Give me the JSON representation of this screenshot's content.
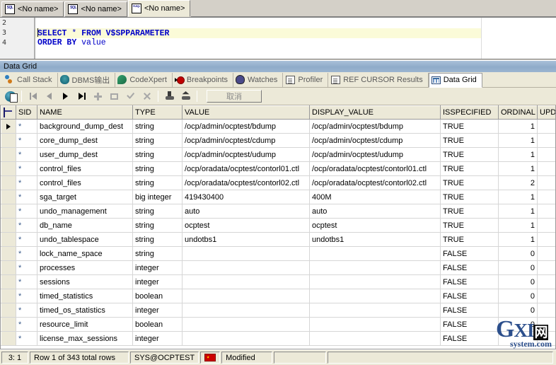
{
  "document_tabs": [
    {
      "label": "<No name>",
      "icon": "sql-document-icon",
      "active": false
    },
    {
      "label": "<No name>",
      "icon": "sql-document-icon",
      "active": false
    },
    {
      "label": "<No name>",
      "icon": "plsql-document-icon",
      "active": true
    }
  ],
  "editor": {
    "gutter": [
      "2",
      "3",
      "4"
    ],
    "lines": [
      {
        "number": "2",
        "text": "",
        "current": false
      },
      {
        "number": "3",
        "text": "SELECT * FROM V$SPPARAMETER",
        "current": true
      },
      {
        "number": "4",
        "text": "ORDER BY value",
        "current": false
      }
    ],
    "line3": {
      "kw_select": "SELECT",
      "star": " * ",
      "kw_from": "FROM",
      "table": " V$SPPARAMETER"
    },
    "line4": {
      "kw_order": "ORDER",
      "kw_by": " BY",
      "column": " value"
    }
  },
  "panel": {
    "title": "Data Grid"
  },
  "subtabs": [
    {
      "label": "Call Stack",
      "icon": "call-stack-icon",
      "active": false
    },
    {
      "label": "DBMS输出",
      "icon": "dbms-output-icon",
      "active": false
    },
    {
      "label": "CodeXpert",
      "icon": "codexpert-icon",
      "active": false
    },
    {
      "label": "Breakpoints",
      "icon": "breakpoint-icon",
      "active": false
    },
    {
      "label": "Watches",
      "icon": "watches-icon",
      "active": false
    },
    {
      "label": "Profiler",
      "icon": "profiler-icon",
      "active": false
    },
    {
      "label": "REF CURSOR Results",
      "icon": "ref-cursor-icon",
      "active": false
    },
    {
      "label": "Data Grid",
      "icon": "data-grid-icon",
      "active": true
    }
  ],
  "grid_toolbar": {
    "buttons": [
      "refresh-icon",
      "first-record-icon",
      "prior-record-icon",
      "next-record-icon",
      "last-record-icon",
      "insert-record-icon",
      "delete-record-icon",
      "post-edit-icon",
      "cancel-edit-icon",
      "commit-icon",
      "rollback-icon"
    ],
    "cancel_label": "取消"
  },
  "grid": {
    "columns": [
      "SID",
      "NAME",
      "TYPE",
      "VALUE",
      "DISPLAY_VALUE",
      "ISSPECIFIED",
      "ORDINAL",
      "UPDA"
    ],
    "selector_icon": "edit-pencil-icon",
    "rows": [
      {
        "current": true,
        "sid": "*",
        "name": "background_dump_dest",
        "type": "string",
        "value": "/ocp/admin/ocptest/bdump",
        "display_value": "/ocp/admin/ocptest/bdump",
        "isspecified": "TRUE",
        "ordinal": "1",
        "upda": ""
      },
      {
        "current": false,
        "sid": "*",
        "name": "core_dump_dest",
        "type": "string",
        "value": "/ocp/admin/ocptest/cdump",
        "display_value": "/ocp/admin/ocptest/cdump",
        "isspecified": "TRUE",
        "ordinal": "1",
        "upda": ""
      },
      {
        "current": false,
        "sid": "*",
        "name": "user_dump_dest",
        "type": "string",
        "value": "/ocp/admin/ocptest/udump",
        "display_value": "/ocp/admin/ocptest/udump",
        "isspecified": "TRUE",
        "ordinal": "1",
        "upda": ""
      },
      {
        "current": false,
        "sid": "*",
        "name": "control_files",
        "type": "string",
        "value": "/ocp/oradata/ocptest/contorl01.ctl",
        "display_value": "/ocp/oradata/ocptest/contorl01.ctl",
        "isspecified": "TRUE",
        "ordinal": "1",
        "upda": ""
      },
      {
        "current": false,
        "sid": "*",
        "name": "control_files",
        "type": "string",
        "value": "/ocp/oradata/ocptest/contorl02.ctl",
        "display_value": "/ocp/oradata/ocptest/contorl02.ctl",
        "isspecified": "TRUE",
        "ordinal": "2",
        "upda": ""
      },
      {
        "current": false,
        "sid": "*",
        "name": "sga_target",
        "type": "big integer",
        "value": "419430400",
        "display_value": "400M",
        "isspecified": "TRUE",
        "ordinal": "1",
        "upda": ""
      },
      {
        "current": false,
        "sid": "*",
        "name": "undo_management",
        "type": "string",
        "value": "auto",
        "display_value": "auto",
        "isspecified": "TRUE",
        "ordinal": "1",
        "upda": ""
      },
      {
        "current": false,
        "sid": "*",
        "name": "db_name",
        "type": "string",
        "value": "ocptest",
        "display_value": "ocptest",
        "isspecified": "TRUE",
        "ordinal": "1",
        "upda": ""
      },
      {
        "current": false,
        "sid": "*",
        "name": "undo_tablespace",
        "type": "string",
        "value": "undotbs1",
        "display_value": "undotbs1",
        "isspecified": "TRUE",
        "ordinal": "1",
        "upda": ""
      },
      {
        "current": false,
        "sid": "*",
        "name": "lock_name_space",
        "type": "string",
        "value": "",
        "display_value": "",
        "isspecified": "FALSE",
        "ordinal": "0",
        "upda": ""
      },
      {
        "current": false,
        "sid": "*",
        "name": "processes",
        "type": "integer",
        "value": "",
        "display_value": "",
        "isspecified": "FALSE",
        "ordinal": "0",
        "upda": ""
      },
      {
        "current": false,
        "sid": "*",
        "name": "sessions",
        "type": "integer",
        "value": "",
        "display_value": "",
        "isspecified": "FALSE",
        "ordinal": "0",
        "upda": ""
      },
      {
        "current": false,
        "sid": "*",
        "name": "timed_statistics",
        "type": "boolean",
        "value": "",
        "display_value": "",
        "isspecified": "FALSE",
        "ordinal": "0",
        "upda": ""
      },
      {
        "current": false,
        "sid": "*",
        "name": "timed_os_statistics",
        "type": "integer",
        "value": "",
        "display_value": "",
        "isspecified": "FALSE",
        "ordinal": "0",
        "upda": ""
      },
      {
        "current": false,
        "sid": "*",
        "name": "resource_limit",
        "type": "boolean",
        "value": "",
        "display_value": "",
        "isspecified": "FALSE",
        "ordinal": "0",
        "upda": ""
      },
      {
        "current": false,
        "sid": "*",
        "name": "license_max_sessions",
        "type": "integer",
        "value": "",
        "display_value": "",
        "isspecified": "FALSE",
        "ordinal": "",
        "upda": ""
      }
    ]
  },
  "statusbar": {
    "position": "3:  1",
    "rows": "Row 1 of 343 total rows",
    "session": "SYS@OCPTEST",
    "flag_icon": "china-flag-icon",
    "state": "Modified"
  },
  "watermark": {
    "g": "G",
    "xi": "XI",
    "cn": "网",
    "domain": "system.com"
  }
}
